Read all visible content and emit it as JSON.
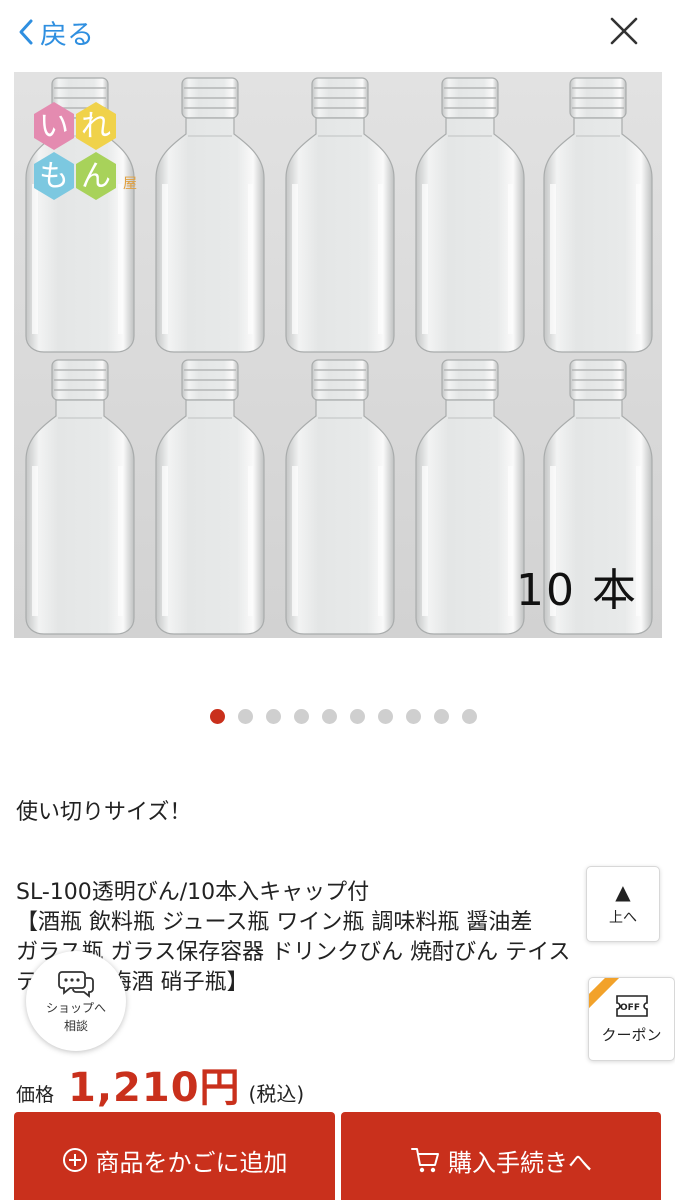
{
  "header": {
    "back_label": "戻る"
  },
  "gallery": {
    "logo_text": [
      "い",
      "れ",
      "も",
      "ん",
      "屋"
    ],
    "quantity_label": "10 本",
    "dot_count": 10,
    "active_dot": 0
  },
  "product": {
    "catch_copy": "使い切りサイズ！",
    "title_line1": "SL-100透明びん/10本入キャップ付",
    "title_line2": "【酒瓶 飲料瓶 ジュース瓶 ワイン瓶 調味料瓶 醤油差",
    "title_line3": "ガラス瓶 ガラス保存容器 ドリンクびん 焼酎びん テイス",
    "title_line4": "ティング 梅酒 硝子瓶】"
  },
  "price": {
    "label": "価格",
    "value": "1,210円",
    "tax": "(税込)"
  },
  "buttons": {
    "add_to_cart": "商品をかごに追加",
    "checkout": "購入手続きへ"
  },
  "floating": {
    "scroll_top_label": "上へ",
    "coupon_label": "クーポン",
    "coupon_icon_text": "OFF",
    "shop_label_line1": "ショップへ",
    "shop_label_line2": "相談"
  },
  "colors": {
    "accent": "#c9301c",
    "link": "#2f8fe0",
    "coupon_ribbon": "#f2a22a"
  }
}
